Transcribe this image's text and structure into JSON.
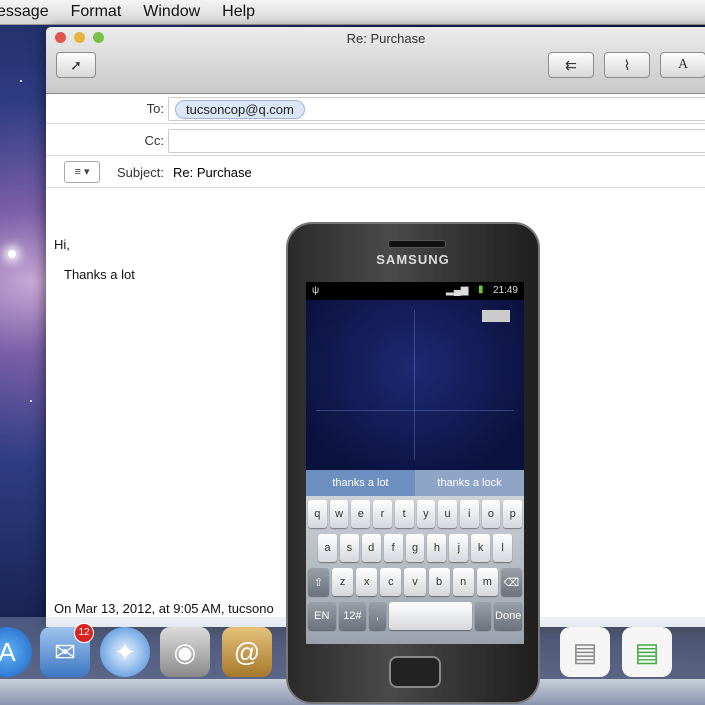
{
  "menubar": {
    "items": [
      "essage",
      "Format",
      "Window",
      "Help"
    ]
  },
  "window": {
    "title": "Re: Purchase"
  },
  "header": {
    "to_label": "To:",
    "to_value": "tucsoncop@q.com",
    "cc_label": "Cc:",
    "subject_label": "Subject:",
    "subject_value": "Re: Purchase",
    "format_menu": "≡ ▾"
  },
  "body": {
    "greeting": "Hi,",
    "line1": "Thanks a lot",
    "quote": "On Mar 13, 2012, at 9:05 AM, tucsono"
  },
  "phone": {
    "brand": "SAMSUNG",
    "time": "21:49",
    "suggestions": [
      "thanks a lot",
      "thanks a lock"
    ],
    "rows": [
      [
        "q",
        "w",
        "e",
        "r",
        "t",
        "y",
        "u",
        "i",
        "o",
        "p"
      ],
      [
        "a",
        "s",
        "d",
        "f",
        "g",
        "h",
        "j",
        "k",
        "l"
      ],
      [
        "⇧",
        "z",
        "x",
        "c",
        "v",
        "b",
        "n",
        "m",
        "⌫"
      ],
      [
        "EN",
        "12#",
        ",",
        "",
        "",
        "",
        "Done"
      ]
    ]
  },
  "dock": {
    "badge": "12"
  },
  "colors": {
    "accent": "#3b6fc9",
    "suggest_active": "#6d8fbf",
    "suggest_bg": "#8ea5c6"
  }
}
